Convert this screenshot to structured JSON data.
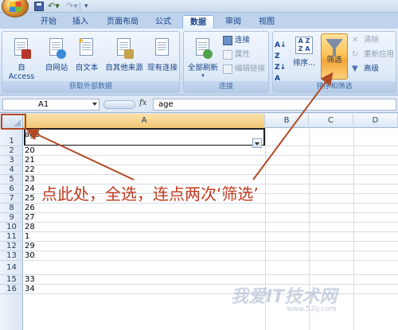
{
  "quick_access": {
    "save_icon": "save-icon",
    "undo_icon": "undo-icon",
    "redo_icon": "redo-icon",
    "more_icon": "customize-icon"
  },
  "tabs": [
    {
      "label": "开始"
    },
    {
      "label": "插入"
    },
    {
      "label": "页面布局"
    },
    {
      "label": "公式"
    },
    {
      "label": "数据",
      "active": true
    },
    {
      "label": "审阅"
    },
    {
      "label": "视图"
    }
  ],
  "ribbon": {
    "external_data": {
      "label": "获取外部数据",
      "from_access": "自 Access",
      "from_web": "自网站",
      "from_text": "自文本",
      "from_other": "自其他来源",
      "existing_connections": "现有连接"
    },
    "connections": {
      "label": "连接",
      "refresh_all": "全部刷新",
      "connections": "连接",
      "properties": "属性",
      "edit_links": "编辑链接"
    },
    "sort_filter": {
      "label": "排序和筛选",
      "sort": "排序...",
      "filter": "筛选",
      "clear": "清除",
      "reapply": "重新应用",
      "advanced": "高级"
    }
  },
  "formula_bar": {
    "name_box": "A1",
    "fx": "fx",
    "content": "age"
  },
  "grid": {
    "columns": [
      "A",
      "B",
      "C",
      "D"
    ],
    "rows": [
      {
        "num": "1",
        "value": "age"
      },
      {
        "num": "2",
        "value": "20"
      },
      {
        "num": "3",
        "value": "21"
      },
      {
        "num": "4",
        "value": "22"
      },
      {
        "num": "5",
        "value": "23"
      },
      {
        "num": "6",
        "value": "24"
      },
      {
        "num": "7",
        "value": "25"
      },
      {
        "num": "8",
        "value": "26"
      },
      {
        "num": "9",
        "value": "27"
      },
      {
        "num": "10",
        "value": "28"
      },
      {
        "num": "11",
        "value": "1"
      },
      {
        "num": "12",
        "value": "29"
      },
      {
        "num": "13",
        "value": "30"
      },
      {
        "num": "14",
        "value": ""
      },
      {
        "num": "15",
        "value": "33"
      },
      {
        "num": "16",
        "value": "34"
      }
    ]
  },
  "annotation": "点此处，全选，连点两次‘筛选’",
  "watermark": "我爱IT技术网",
  "watermark_url": "www.52ij.com",
  "colors": {
    "annotation": "#c0391d",
    "filter_active": "#ffc45a"
  }
}
